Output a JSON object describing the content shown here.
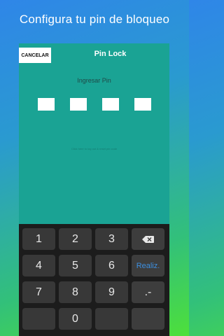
{
  "promo": {
    "heading": "Configura tu pin de bloqueo"
  },
  "topbar": {
    "cancel_label": "CANCELAR",
    "title": "Pin Lock"
  },
  "pin": {
    "prompt": "Ingresar Pin",
    "hint": "Click here to log out & reset pin code"
  },
  "keypad": {
    "keys": [
      "1",
      "2",
      "3",
      "4",
      "5",
      "6",
      "7",
      "8",
      "9",
      "0",
      ".-"
    ],
    "enter_label": "Realiz."
  }
}
